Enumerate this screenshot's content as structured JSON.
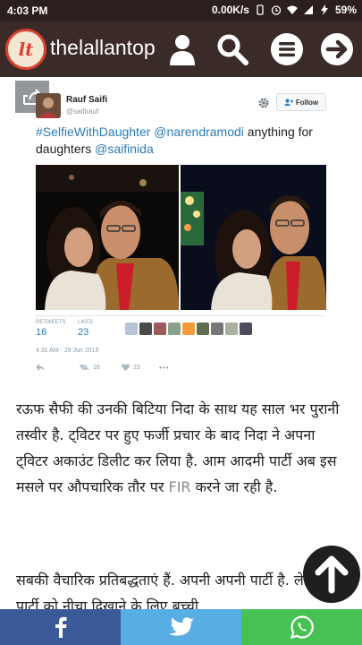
{
  "status_bar": {
    "time": "4:03 PM",
    "network_speed": "0.00K/s",
    "battery": "59%"
  },
  "header": {
    "logo_text": "lt",
    "brand": "thelallantop",
    "icons": [
      "person-icon",
      "search-icon",
      "menu-icon",
      "arrow-right-icon"
    ]
  },
  "tweet": {
    "author_name": "Rauf Saifi",
    "author_handle": "@saifirauf",
    "follow_label": "Follow",
    "text_parts": [
      "#SelfieWithDaughter",
      "@narendramodi",
      "anything for daughters",
      "@saifinida"
    ],
    "retweets_label": "RETWEETS",
    "retweets": "16",
    "likes_label": "LIKES",
    "likes": "23",
    "date": "4:31 AM - 29 Jun 2015",
    "action_retweets": "16",
    "action_likes": "23",
    "more": "•••"
  },
  "article": {
    "para1": "रऊफ सैफी की उनकी बिटिया निदा के साथ यह साल भर पुरानी तस्वीर है. ट्विटर पर हुए फर्जी प्रचार के बाद निदा ने अपना ट्विटर अकाउंट डिलीट कर लिया है. आम आदमी पार्टी अब इस मसले पर औपचारिक तौर पर",
    "fir": "FIR",
    "para1_end": "करने जा रही है.",
    "para2": "सबकी वैचारिक प्रतिबद्धताएं हैं. अपनी अपनी पार्टी है. लेकिन पार्टी को नीचा दिखाने के लिए बच्ची"
  },
  "colors": {
    "header_bg": "#3a2b29",
    "link_blue": "#2b7bb9",
    "facebook": "#3b5998",
    "twitter": "#58aee3",
    "whatsapp": "#47c054"
  },
  "share_bar": [
    "facebook-icon",
    "twitter-icon",
    "whatsapp-icon"
  ]
}
